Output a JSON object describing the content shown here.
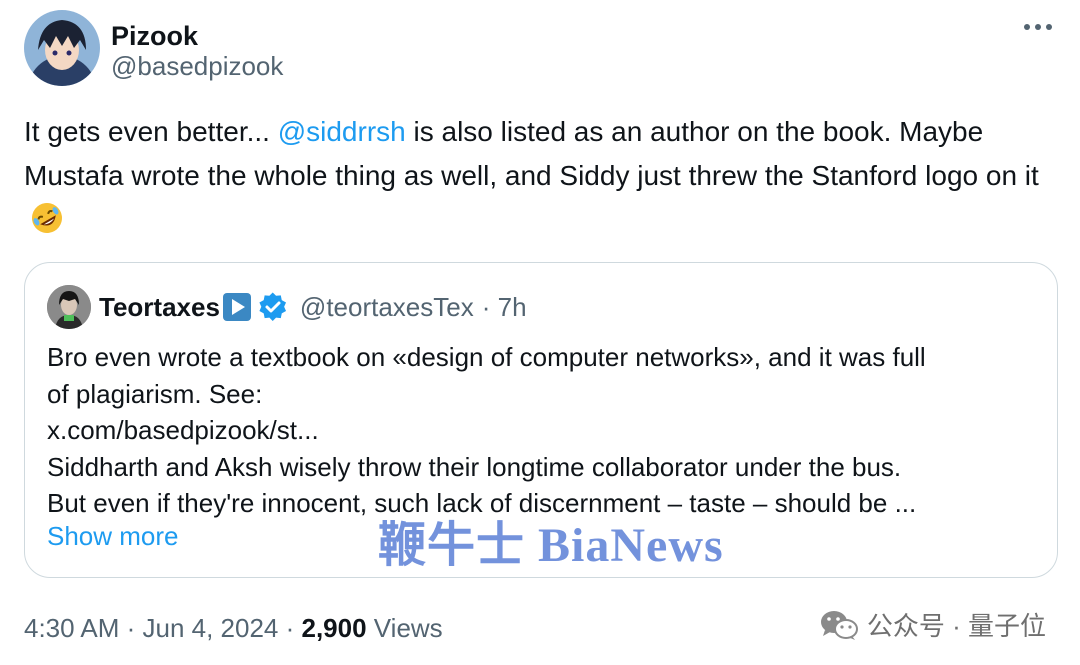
{
  "author": {
    "name": "Pizook",
    "handle": "@basedpizook"
  },
  "tweet": {
    "text_before": "It gets even better... ",
    "mention": "@siddrrsh",
    "text_after": " is also listed as an author on the book. Maybe Mustafa wrote the whole thing as well, and Siddy just threw the Stanford logo on it",
    "emoji": "rolling-on-floor-laughing"
  },
  "quoted_tweet": {
    "name": "Teortaxes",
    "handle": "@teortaxesTex",
    "time": "· 7h",
    "lines": [
      "Bro even wrote a textbook on «design of computer networks», and it was full",
      "of plagiarism. See:",
      "x.com/basedpizook/st...",
      "Siddharth and Aksh wisely throw their longtime collaborator under the bus.",
      "But even if they're innocent, such lack of discernment – taste – should be ..."
    ],
    "show_more": "Show more"
  },
  "footer": {
    "time": "4:30 AM · Jun 4, 2024 · ",
    "views_count": "2,900",
    "views_label": " Views"
  },
  "watermark": {
    "text": "鞭牛士 BiaNews"
  },
  "wechat": {
    "label": "公众号 · 量子位"
  },
  "colors": {
    "link": "#1d9bf0",
    "secondary_text": "#536471",
    "border": "#cfd9de",
    "verified": "#1d9bf0"
  }
}
